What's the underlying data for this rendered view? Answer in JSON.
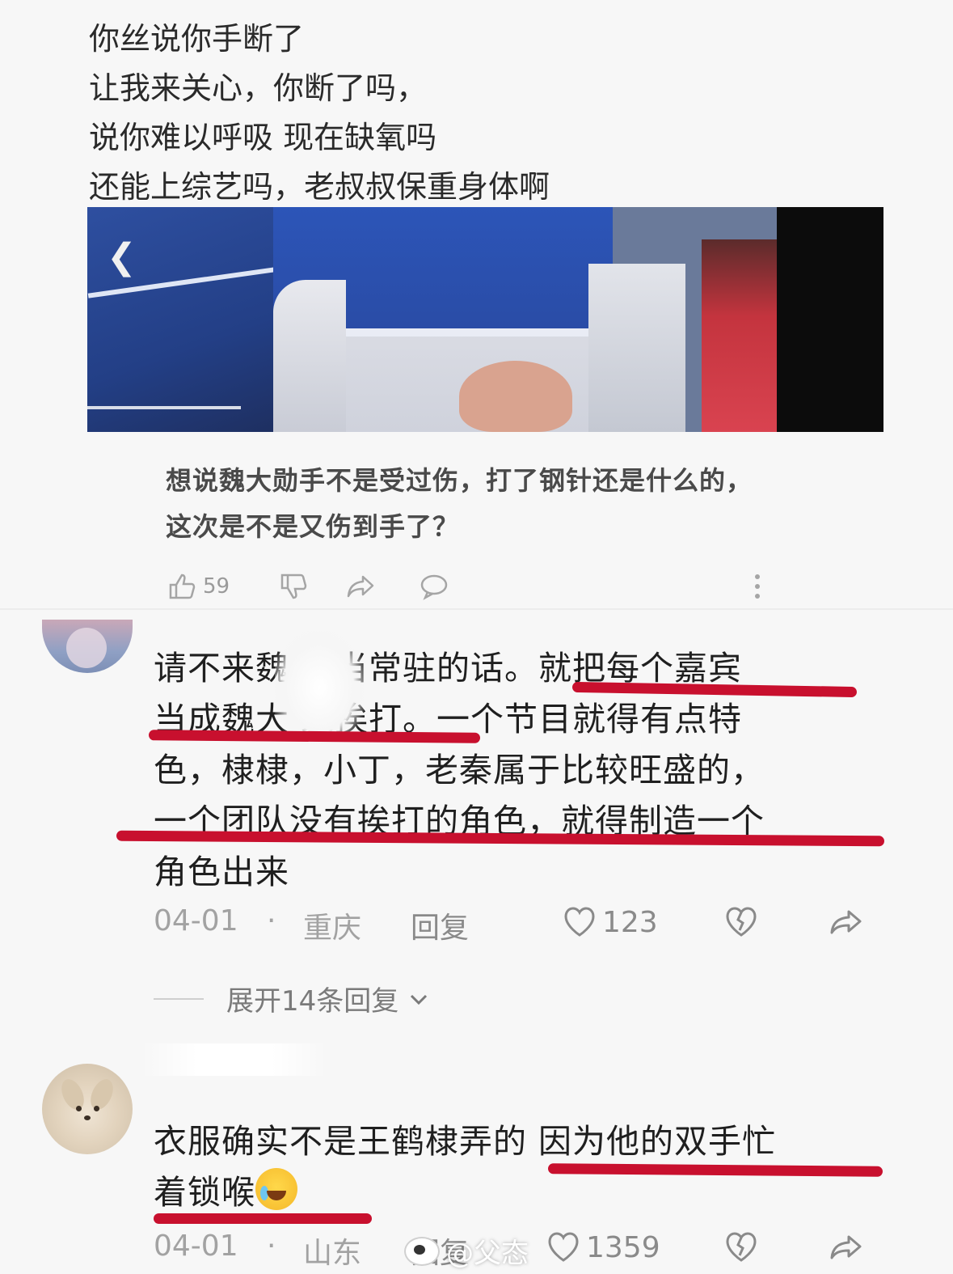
{
  "post": {
    "poem_lines": [
      "你丝说你手断了",
      "让我来关心，你断了吗，",
      "说你难以呼吸 现在缺氧吗",
      "还能上综艺吗，老叔叔保重身体啊"
    ],
    "question": "想说魏大勋手不是受过伤，打了钢针还是什么的，这次是不是又伤到手了？",
    "actions": {
      "like_count": "59",
      "like_icon": "thumbs-up-icon",
      "dislike_icon": "thumbs-down-icon",
      "share_icon": "share-icon",
      "comment_icon": "comment-icon",
      "more_icon": "more-vertical-icon"
    }
  },
  "comments": [
    {
      "lines": [
        "请不来魏大 当常驻的话。就把每个嘉宾",
        "当成魏大 来挨打。一个节目就得有点特",
        "色，棣棣，小丁，老秦属于比较旺盛的，",
        "一个团队没有挨打的角色，就得制造一个",
        "角色出来"
      ],
      "date": "04-01",
      "dot": "·",
      "location": "重庆",
      "reply_label": "回复",
      "like_count": "123",
      "expand_label": "展开14条回复"
    },
    {
      "lines": [
        "衣服确实不是王鹤棣弄的 因为他的双手忙",
        "着锁喉"
      ],
      "date": "04-01",
      "dot": "·",
      "location": "山东",
      "reply_label": "回复",
      "like_count": "1359"
    }
  ],
  "watermark": "@父态",
  "colors": {
    "underline": "#c8102e",
    "meta_gray": "#a2a2a2",
    "background": "#f7f7f7"
  }
}
